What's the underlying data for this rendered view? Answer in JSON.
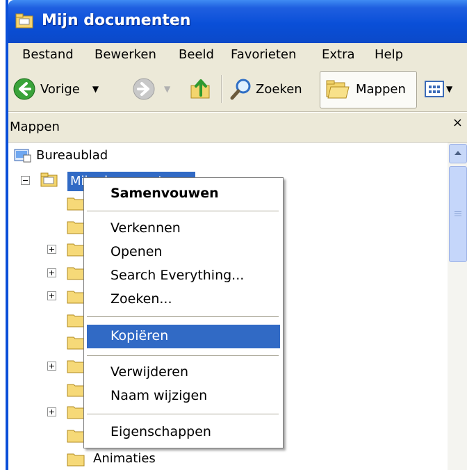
{
  "window": {
    "title": "Mijn documenten"
  },
  "menubar": [
    "Bestand",
    "Bewerken",
    "Beeld",
    "Favorieten",
    "Extra",
    "Help"
  ],
  "toolbar": {
    "back_label": "Vorige",
    "search_label": "Zoeken",
    "folders_label": "Mappen"
  },
  "pane": {
    "title": "Mappen",
    "close": "×"
  },
  "tree": {
    "root": "Bureaublad",
    "selected": "Mijn documenten",
    "last_visible": "Animaties"
  },
  "context_menu": {
    "items": [
      "Samenvouwen",
      "Verkennen",
      "Openen",
      "Search Everything...",
      "Zoeken...",
      "Kopiëren",
      "Verwijderen",
      "Naam wijzigen",
      "Eigenschappen"
    ],
    "highlighted": "Kopiëren"
  },
  "icons": [
    "folder-window-icon",
    "back-arrow-icon",
    "forward-arrow-icon",
    "up-folder-icon",
    "search-icon",
    "folders-icon",
    "views-icon",
    "desktop-icon",
    "my-documents-icon",
    "folder-icon"
  ],
  "colors": {
    "title_bar": "#0a4fd8",
    "selection": "#316ac5",
    "chrome": "#ece9d8"
  }
}
